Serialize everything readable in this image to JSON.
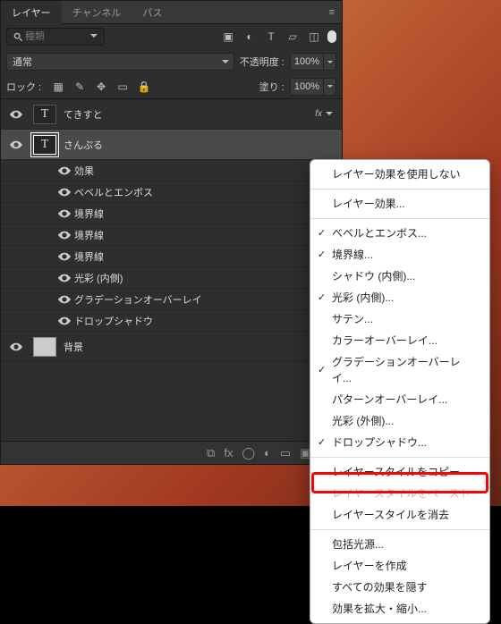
{
  "tabs": {
    "layers": "レイヤー",
    "channels": "チャンネル",
    "paths": "パス"
  },
  "search": {
    "placeholder": "種類"
  },
  "blend": {
    "mode": "通常",
    "opacity_label": "不透明度 :",
    "opacity": "100%"
  },
  "lock": {
    "label": "ロック :",
    "fill_label": "塗り :",
    "fill": "100%"
  },
  "layers": {
    "tekisuto": "てきすと",
    "sample": "さんぷる",
    "effects": "効果",
    "bevel": "ベベルとエンボス",
    "stroke1": "境界線",
    "stroke2": "境界線",
    "stroke3": "境界線",
    "innerglow": "光彩 (内側)",
    "gradient": "グラデーションオーバーレイ",
    "dropshadow": "ドロップシャドウ",
    "bg": "背景",
    "fx": "fx"
  },
  "menu": {
    "disable": "レイヤー効果を使用しない",
    "layereffects": "レイヤー効果...",
    "bevel": "ベベルとエンボス...",
    "stroke": "境界線...",
    "innershadow": "シャドウ (内側)...",
    "innerglow": "光彩 (内側)...",
    "satin": "サテン...",
    "coloroverlay": "カラーオーバーレイ...",
    "gradientoverlay": "グラデーションオーバーレイ...",
    "patternoverlay": "パターンオーバーレイ...",
    "outerglow": "光彩 (外側)...",
    "dropshadow": "ドロップシャドウ...",
    "copystyle": "レイヤースタイルをコピー",
    "pastestyle": "レイヤースタイルをペースト",
    "clearstyle": "レイヤースタイルを消去",
    "globallight": "包括光源...",
    "createlayer": "レイヤーを作成",
    "hideall": "すべての効果を隠す",
    "scale": "効果を拡大・縮小..."
  }
}
